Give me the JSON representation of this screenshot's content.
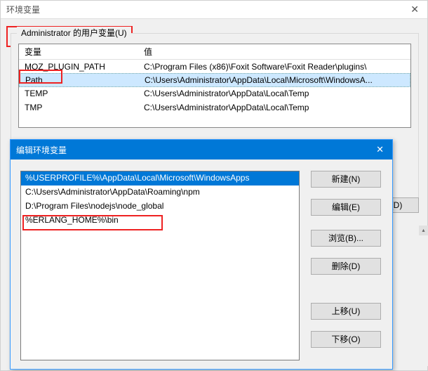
{
  "parent": {
    "title": "环境变量",
    "close": "✕",
    "group_legend": "Administrator 的用户变量(U)",
    "columns": {
      "name": "变量",
      "value": "值"
    },
    "rows": [
      {
        "name": "MOZ_PLUGIN_PATH",
        "value": "C:\\Program Files (x86)\\Foxit Software\\Foxit Reader\\plugins\\"
      },
      {
        "name": "Path",
        "value": "C:\\Users\\Administrator\\AppData\\Local\\Microsoft\\WindowsA..."
      },
      {
        "name": "TEMP",
        "value": "C:\\Users\\Administrator\\AppData\\Local\\Temp"
      },
      {
        "name": "TMP",
        "value": "C:\\Users\\Administrator\\AppData\\Local\\Temp"
      }
    ],
    "selected_index": 1,
    "buttons": {
      "delete": "除(D)"
    }
  },
  "child": {
    "title": "编辑环境变量",
    "close": "✕",
    "entries": [
      "%USERPROFILE%\\AppData\\Local\\Microsoft\\WindowsApps",
      "C:\\Users\\Administrator\\AppData\\Roaming\\npm",
      "D:\\Program Files\\nodejs\\node_global",
      "%ERLANG_HOME%\\bin"
    ],
    "selected_index": 0,
    "buttons": {
      "new": "新建(N)",
      "edit": "编辑(E)",
      "browse": "浏览(B)...",
      "delete": "删除(D)",
      "moveup": "上移(U)",
      "movedown": "下移(O)"
    }
  },
  "scroll": {
    "up": "▴",
    "down": "▾"
  }
}
